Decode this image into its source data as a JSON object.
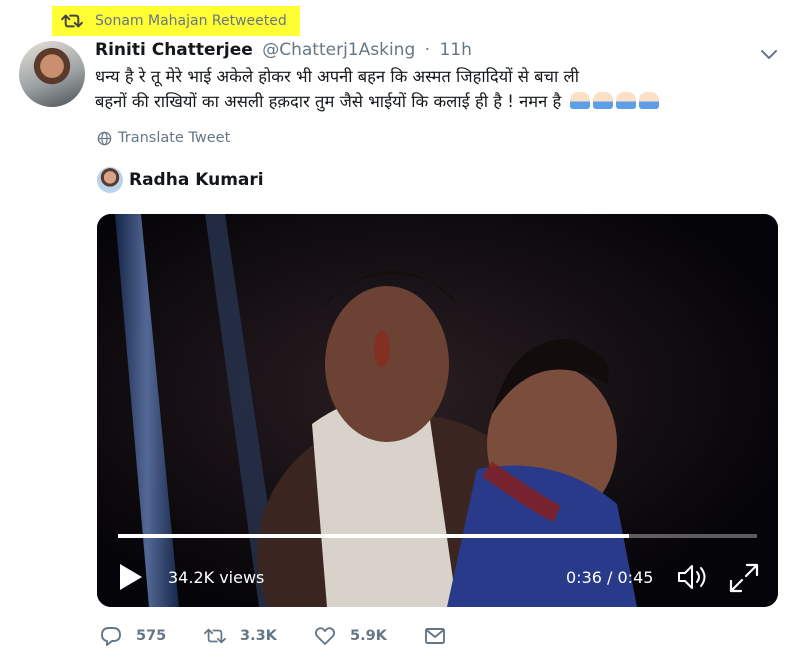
{
  "retweet_banner": {
    "text": "Sonam Mahajan Retweeted",
    "highlight_color": "#ffff33"
  },
  "tweet": {
    "author_name": "Riniti Chatterjee",
    "author_handle": "@Chatterj1Asking",
    "separator": "·",
    "time": "11h",
    "text_line1": "धन्य है रे तू मेरे भाई अकेले होकर भी अपनी बहन कि अस्मत जिहादियों से बचा ली",
    "text_line2": "बहनों की राखियों का असली हक़दार तुम जैसे भाईयों कि कलाई ही है ! नमन है",
    "emoji": "folded-hands x4",
    "translate_label": "Translate Tweet"
  },
  "quoted": {
    "name": "Radha Kumari"
  },
  "video": {
    "views": "34.2K views",
    "time_display": "0:36 / 0:45",
    "progress": 0.8
  },
  "actions": {
    "replies": "575",
    "retweets": "3.3K",
    "likes": "5.9K"
  },
  "colors": {
    "text": "#14171a",
    "secondary": "#657786",
    "video_bg": "#07060b"
  }
}
